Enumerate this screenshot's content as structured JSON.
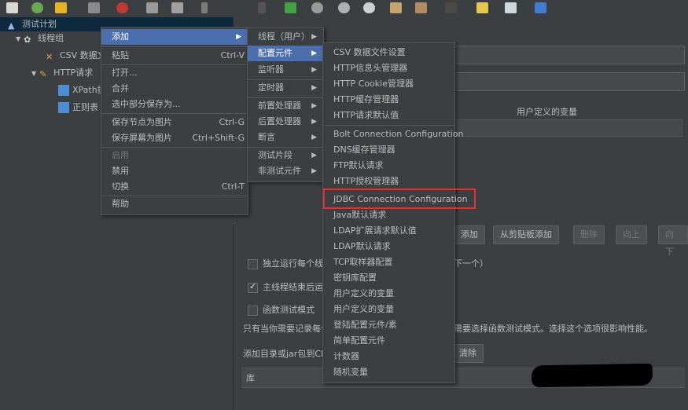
{
  "toolbar": {
    "icons": [
      "new-icon",
      "templates-icon",
      "open-icon",
      "save-icon",
      "cut-icon",
      "copy-icon",
      "paste-icon",
      "expand-icon",
      "run-icon",
      "run-no-pause-icon",
      "stop-icon",
      "shutdown-icon",
      "clear-icon",
      "clear-all-icon",
      "search-icon",
      "reset-icon",
      "function-icon",
      "help-icon"
    ]
  },
  "tree": {
    "test_plan": "测试计划",
    "thread_group": "线程组",
    "csv": "CSV 数据文",
    "http": "HTTP请求",
    "xpath": "XPath提",
    "regex": "正则表"
  },
  "context_menu": {
    "items": [
      {
        "label": "添加",
        "shortcut": "",
        "submenu": true,
        "highlight": true
      },
      {
        "label": "粘贴",
        "shortcut": "Ctrl-V"
      },
      {
        "label": "打开...",
        "shortcut": ""
      },
      {
        "label": "合并",
        "shortcut": ""
      },
      {
        "label": "选中部分保存为...",
        "shortcut": ""
      },
      {
        "label": "保存节点为图片",
        "shortcut": "Ctrl-G"
      },
      {
        "label": "保存屏幕为图片",
        "shortcut": "Ctrl+Shift-G"
      },
      {
        "label": "启用",
        "shortcut": "",
        "disabled": true
      },
      {
        "label": "禁用",
        "shortcut": ""
      },
      {
        "label": "切换",
        "shortcut": "Ctrl-T"
      },
      {
        "label": "帮助",
        "shortcut": ""
      }
    ]
  },
  "add_menu": {
    "items": [
      "线程（用户）",
      "配置元件",
      "监听器",
      "定时器",
      "前置处理器",
      "后置处理器",
      "断言",
      "测试片段",
      "非测试元件"
    ]
  },
  "config_menu": {
    "items": [
      "CSV 数据文件设置",
      "HTTP信息头管理器",
      "HTTP Cookie管理器",
      "HTTP缓存管理器",
      "HTTP请求默认值",
      "Bolt Connection Configuration",
      "DNS缓存管理器",
      "FTP默认请求",
      "HTTP授权管理器",
      "JDBC Connection Configuration",
      "Java默认请求",
      "LDAP扩展请求默认值",
      "LDAP默认请求",
      "TCP取样器配置",
      "密钥库配置",
      "用户定义的变量",
      "用户定义的变量",
      "登陆配置元件/素",
      "简单配置元件",
      "计数器",
      "随机变量"
    ]
  },
  "right_panel": {
    "user_vars_header": "用户定义的变量",
    "buttons": {
      "add": "添加",
      "add_clipboard": "从剪贴板添加",
      "delete": "删除",
      "up": "向上",
      "down": "向下"
    },
    "cb_independent": "独立运行每个线程",
    "cb_independent_tail": "下一个）",
    "cb_teardown": "主线程结束后运行",
    "cb_functional": "函数测试模式",
    "note_head": "只有当你需要记录每个",
    "note_tail": "需要选择函数测试模式。选择这个选项很影响性能。",
    "classpath_label": "添加目录或jar包到Cla",
    "clear": "清除",
    "lib_header": "库"
  },
  "colors": {
    "highlight": "#4b6eaf",
    "annotation": "#e03030",
    "background": "#3c3f41"
  }
}
